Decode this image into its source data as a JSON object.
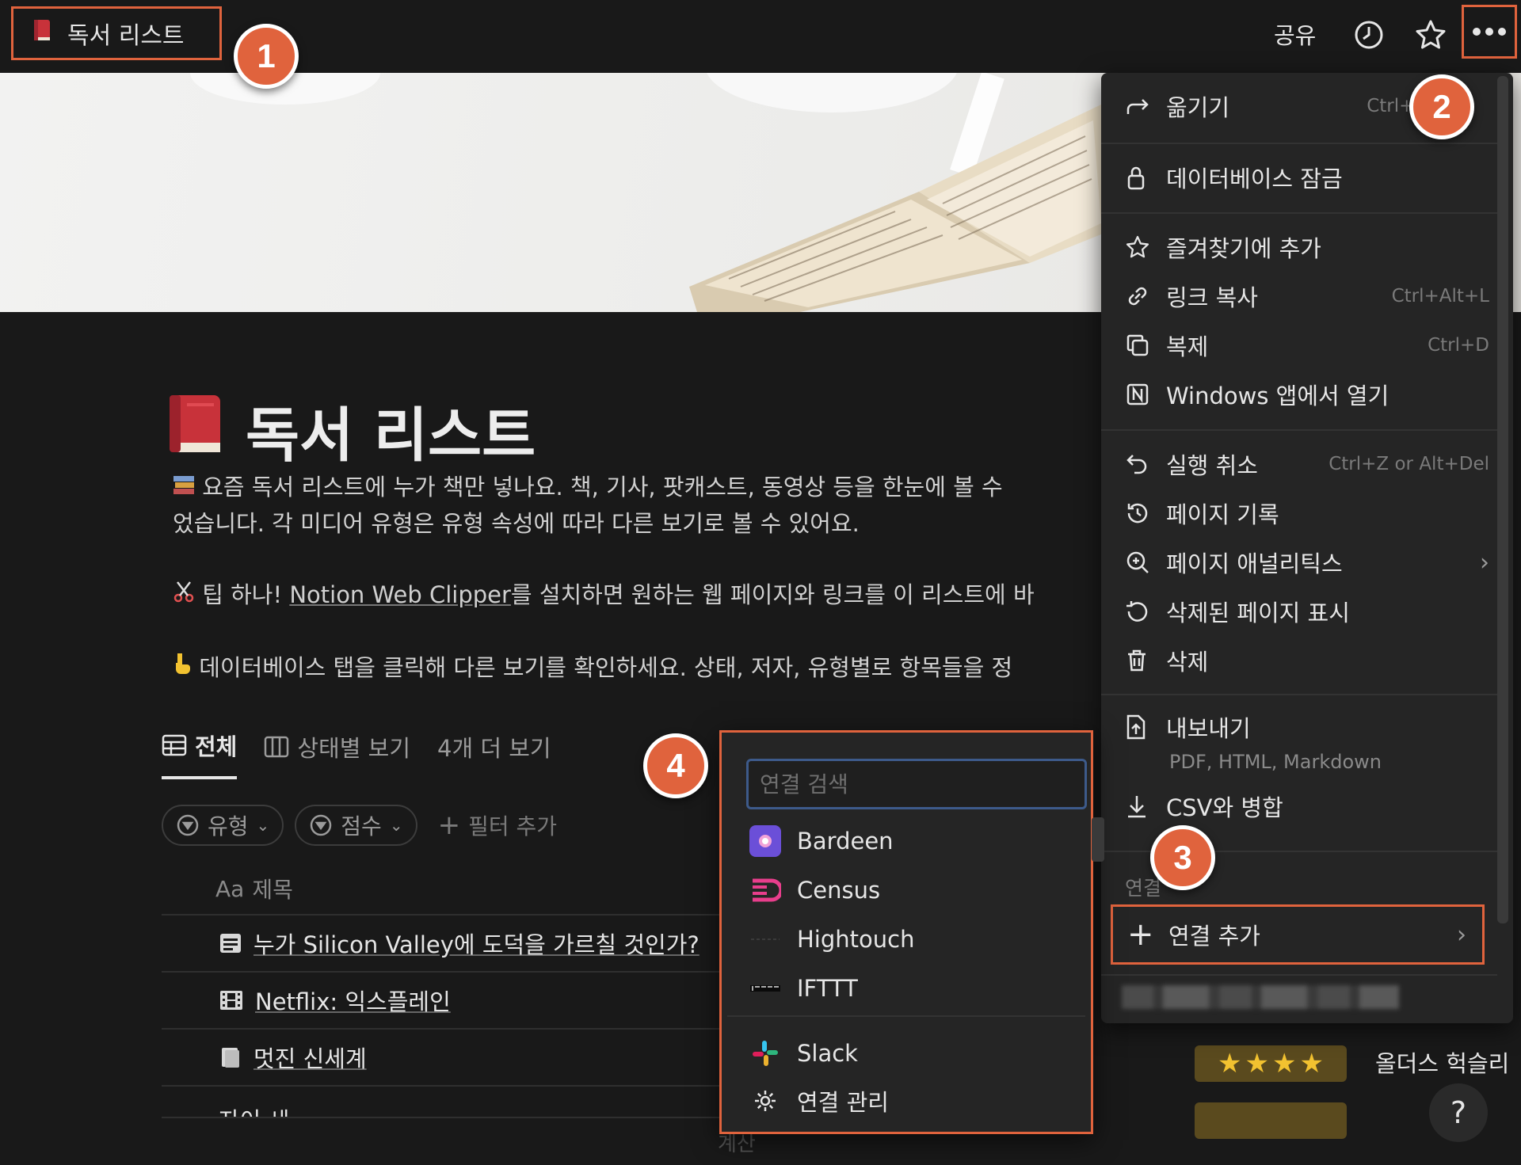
{
  "topbar": {
    "page_title": "독서 리스트",
    "share_label": "공유"
  },
  "page": {
    "title": "독서 리스트",
    "para1_line1": "요즘 독서 리스트에 누가 책만 넣나요. 책, 기사, 팟캐스트, 동영상 등을 한눈에 볼 수",
    "para1_line2": "었습니다. 각 미디어 유형은 유형 속성에 따라 다른 보기로 볼 수 있어요.",
    "para2_prefix": "팁 하나! ",
    "para2_link": "Notion Web Clipper",
    "para2_suffix": "를 설치하면 원하는 웹 페이지와 링크를 이 리스트에 바",
    "para3": "데이터베이스 탭을 클릭해 다른 보기를 확인하세요. 상태, 저자, 유형별로 항목들을 정",
    "tabs": [
      {
        "label": "전체"
      },
      {
        "label": "상태별 보기"
      },
      {
        "label": "4개 더 보기"
      }
    ],
    "filters": [
      {
        "label": "유형"
      },
      {
        "label": "점수"
      }
    ],
    "add_filter": "필터 추가",
    "table": {
      "header_prefix": "Aa",
      "header": "제목",
      "rows": [
        {
          "title": "누가 Silicon Valley에 도덕을 가르칠 것인가?"
        },
        {
          "title": "Netflix: 익스플레인"
        },
        {
          "title": "멋진 신세계"
        },
        {
          "title": "자이 세"
        }
      ]
    },
    "rating": {
      "stars": 4
    },
    "author": "올더스 헉슬리",
    "calc_label": "계산",
    "help": "?"
  },
  "menu": {
    "items": [
      {
        "label": "옮기기",
        "shortcut": "Ctrl+S"
      },
      {
        "label": "데이터베이스 잠금"
      },
      {
        "label": "즐겨찾기에 추가"
      },
      {
        "label": "링크 복사",
        "shortcut": "Ctrl+Alt+L"
      },
      {
        "label": "복제",
        "shortcut": "Ctrl+D"
      },
      {
        "label": "Windows 앱에서 열기"
      },
      {
        "label": "실행 취소",
        "shortcut": "Ctrl+Z or Alt+Del"
      },
      {
        "label": "페이지 기록"
      },
      {
        "label": "페이지 애널리틱스"
      },
      {
        "label": "삭제된 페이지 표시"
      },
      {
        "label": "삭제"
      },
      {
        "label": "내보내기",
        "sub": "PDF, HTML, Markdown"
      },
      {
        "label": "CSV와 병합"
      }
    ],
    "section_label": "연결",
    "add_connection": "연결 추가"
  },
  "submenu": {
    "search_placeholder": "연결 검색",
    "items": [
      {
        "label": "Bardeen"
      },
      {
        "label": "Census"
      },
      {
        "label": "Hightouch"
      },
      {
        "label": "IFTTT"
      },
      {
        "label": "Slack"
      },
      {
        "label": "연결 관리"
      }
    ]
  },
  "badges": [
    "1",
    "2",
    "3",
    "4"
  ],
  "colors": {
    "highlight": "#e0633d",
    "background": "#191919",
    "menu": "#252525",
    "star": "#f2c230"
  }
}
